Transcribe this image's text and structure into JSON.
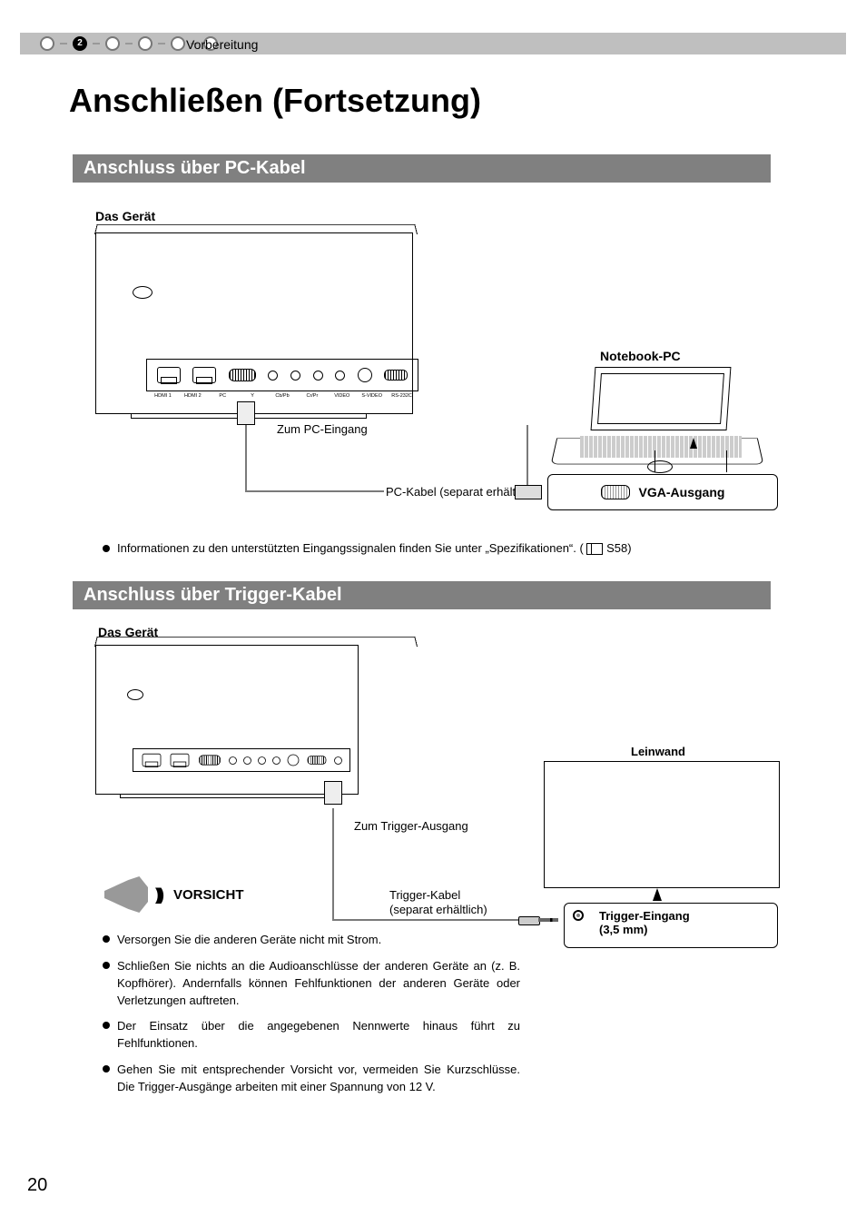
{
  "header": {
    "step_active_number": "2",
    "section_label": "Vorbereitung"
  },
  "title": "Anschließen (Fortsetzung)",
  "section1": {
    "heading": "Anschluss über PC-Kabel",
    "device_label": "Das Gerät",
    "to_input_label": "Zum PC-Eingang",
    "cable_label": "PC-Kabel (separat erhältlich)",
    "notebook_label": "Notebook-PC",
    "vga_out_label": "VGA-Ausgang",
    "note_text": "Informationen zu den unterstützten Eingangssignalen finden Sie unter „Spezifikationen“. (",
    "note_page": "S58)"
  },
  "section2": {
    "heading": "Anschluss über Trigger-Kabel",
    "device_label": "Das Gerät",
    "to_output_label": "Zum Trigger-Ausgang",
    "cable_label_line1": "Trigger-Kabel",
    "cable_label_line2": "(separat erhältlich)",
    "screen_label": "Leinwand",
    "trigger_in_label_line1": "Trigger-Eingang",
    "trigger_in_label_line2": "(3,5 mm)",
    "caution_heading": "VORSICHT",
    "cautions": [
      "Versorgen Sie die anderen Geräte nicht mit Strom.",
      "Schließen Sie nichts an die Audioanschlüsse der anderen Geräte an (z. B. Kopfhörer). Andernfalls können Fehlfunktionen der anderen Geräte oder Verletzungen auftreten.",
      "Der Einsatz über die angegebenen Nennwerte hinaus führt zu Fehlfunktionen.",
      "Gehen Sie mit entsprechender Vorsicht vor, vermeiden Sie Kurzschlüsse. Die Trigger-Ausgänge arbeiten mit einer Spannung von 12 V."
    ]
  },
  "port_labels": [
    "HDMI 1",
    "HDMI 2",
    "PC",
    "Y",
    "Cb/Pb",
    "Cr/Pr",
    "VIDEO",
    "S-VIDEO",
    "RS-232C"
  ],
  "page_number": "20"
}
